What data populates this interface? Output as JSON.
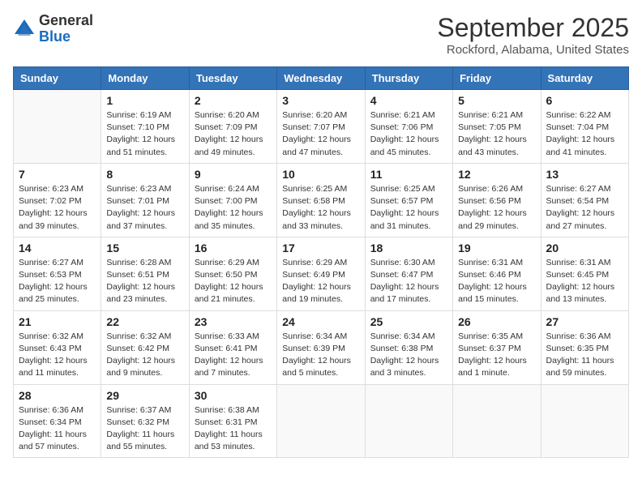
{
  "header": {
    "logo_general": "General",
    "logo_blue": "Blue",
    "month_title": "September 2025",
    "location": "Rockford, Alabama, United States"
  },
  "weekdays": [
    "Sunday",
    "Monday",
    "Tuesday",
    "Wednesday",
    "Thursday",
    "Friday",
    "Saturday"
  ],
  "weeks": [
    [
      {
        "day": "",
        "sunrise": "",
        "sunset": "",
        "daylight": ""
      },
      {
        "day": "1",
        "sunrise": "Sunrise: 6:19 AM",
        "sunset": "Sunset: 7:10 PM",
        "daylight": "Daylight: 12 hours and 51 minutes."
      },
      {
        "day": "2",
        "sunrise": "Sunrise: 6:20 AM",
        "sunset": "Sunset: 7:09 PM",
        "daylight": "Daylight: 12 hours and 49 minutes."
      },
      {
        "day": "3",
        "sunrise": "Sunrise: 6:20 AM",
        "sunset": "Sunset: 7:07 PM",
        "daylight": "Daylight: 12 hours and 47 minutes."
      },
      {
        "day": "4",
        "sunrise": "Sunrise: 6:21 AM",
        "sunset": "Sunset: 7:06 PM",
        "daylight": "Daylight: 12 hours and 45 minutes."
      },
      {
        "day": "5",
        "sunrise": "Sunrise: 6:21 AM",
        "sunset": "Sunset: 7:05 PM",
        "daylight": "Daylight: 12 hours and 43 minutes."
      },
      {
        "day": "6",
        "sunrise": "Sunrise: 6:22 AM",
        "sunset": "Sunset: 7:04 PM",
        "daylight": "Daylight: 12 hours and 41 minutes."
      }
    ],
    [
      {
        "day": "7",
        "sunrise": "Sunrise: 6:23 AM",
        "sunset": "Sunset: 7:02 PM",
        "daylight": "Daylight: 12 hours and 39 minutes."
      },
      {
        "day": "8",
        "sunrise": "Sunrise: 6:23 AM",
        "sunset": "Sunset: 7:01 PM",
        "daylight": "Daylight: 12 hours and 37 minutes."
      },
      {
        "day": "9",
        "sunrise": "Sunrise: 6:24 AM",
        "sunset": "Sunset: 7:00 PM",
        "daylight": "Daylight: 12 hours and 35 minutes."
      },
      {
        "day": "10",
        "sunrise": "Sunrise: 6:25 AM",
        "sunset": "Sunset: 6:58 PM",
        "daylight": "Daylight: 12 hours and 33 minutes."
      },
      {
        "day": "11",
        "sunrise": "Sunrise: 6:25 AM",
        "sunset": "Sunset: 6:57 PM",
        "daylight": "Daylight: 12 hours and 31 minutes."
      },
      {
        "day": "12",
        "sunrise": "Sunrise: 6:26 AM",
        "sunset": "Sunset: 6:56 PM",
        "daylight": "Daylight: 12 hours and 29 minutes."
      },
      {
        "day": "13",
        "sunrise": "Sunrise: 6:27 AM",
        "sunset": "Sunset: 6:54 PM",
        "daylight": "Daylight: 12 hours and 27 minutes."
      }
    ],
    [
      {
        "day": "14",
        "sunrise": "Sunrise: 6:27 AM",
        "sunset": "Sunset: 6:53 PM",
        "daylight": "Daylight: 12 hours and 25 minutes."
      },
      {
        "day": "15",
        "sunrise": "Sunrise: 6:28 AM",
        "sunset": "Sunset: 6:51 PM",
        "daylight": "Daylight: 12 hours and 23 minutes."
      },
      {
        "day": "16",
        "sunrise": "Sunrise: 6:29 AM",
        "sunset": "Sunset: 6:50 PM",
        "daylight": "Daylight: 12 hours and 21 minutes."
      },
      {
        "day": "17",
        "sunrise": "Sunrise: 6:29 AM",
        "sunset": "Sunset: 6:49 PM",
        "daylight": "Daylight: 12 hours and 19 minutes."
      },
      {
        "day": "18",
        "sunrise": "Sunrise: 6:30 AM",
        "sunset": "Sunset: 6:47 PM",
        "daylight": "Daylight: 12 hours and 17 minutes."
      },
      {
        "day": "19",
        "sunrise": "Sunrise: 6:31 AM",
        "sunset": "Sunset: 6:46 PM",
        "daylight": "Daylight: 12 hours and 15 minutes."
      },
      {
        "day": "20",
        "sunrise": "Sunrise: 6:31 AM",
        "sunset": "Sunset: 6:45 PM",
        "daylight": "Daylight: 12 hours and 13 minutes."
      }
    ],
    [
      {
        "day": "21",
        "sunrise": "Sunrise: 6:32 AM",
        "sunset": "Sunset: 6:43 PM",
        "daylight": "Daylight: 12 hours and 11 minutes."
      },
      {
        "day": "22",
        "sunrise": "Sunrise: 6:32 AM",
        "sunset": "Sunset: 6:42 PM",
        "daylight": "Daylight: 12 hours and 9 minutes."
      },
      {
        "day": "23",
        "sunrise": "Sunrise: 6:33 AM",
        "sunset": "Sunset: 6:41 PM",
        "daylight": "Daylight: 12 hours and 7 minutes."
      },
      {
        "day": "24",
        "sunrise": "Sunrise: 6:34 AM",
        "sunset": "Sunset: 6:39 PM",
        "daylight": "Daylight: 12 hours and 5 minutes."
      },
      {
        "day": "25",
        "sunrise": "Sunrise: 6:34 AM",
        "sunset": "Sunset: 6:38 PM",
        "daylight": "Daylight: 12 hours and 3 minutes."
      },
      {
        "day": "26",
        "sunrise": "Sunrise: 6:35 AM",
        "sunset": "Sunset: 6:37 PM",
        "daylight": "Daylight: 12 hours and 1 minute."
      },
      {
        "day": "27",
        "sunrise": "Sunrise: 6:36 AM",
        "sunset": "Sunset: 6:35 PM",
        "daylight": "Daylight: 11 hours and 59 minutes."
      }
    ],
    [
      {
        "day": "28",
        "sunrise": "Sunrise: 6:36 AM",
        "sunset": "Sunset: 6:34 PM",
        "daylight": "Daylight: 11 hours and 57 minutes."
      },
      {
        "day": "29",
        "sunrise": "Sunrise: 6:37 AM",
        "sunset": "Sunset: 6:32 PM",
        "daylight": "Daylight: 11 hours and 55 minutes."
      },
      {
        "day": "30",
        "sunrise": "Sunrise: 6:38 AM",
        "sunset": "Sunset: 6:31 PM",
        "daylight": "Daylight: 11 hours and 53 minutes."
      },
      {
        "day": "",
        "sunrise": "",
        "sunset": "",
        "daylight": ""
      },
      {
        "day": "",
        "sunrise": "",
        "sunset": "",
        "daylight": ""
      },
      {
        "day": "",
        "sunrise": "",
        "sunset": "",
        "daylight": ""
      },
      {
        "day": "",
        "sunrise": "",
        "sunset": "",
        "daylight": ""
      }
    ]
  ]
}
